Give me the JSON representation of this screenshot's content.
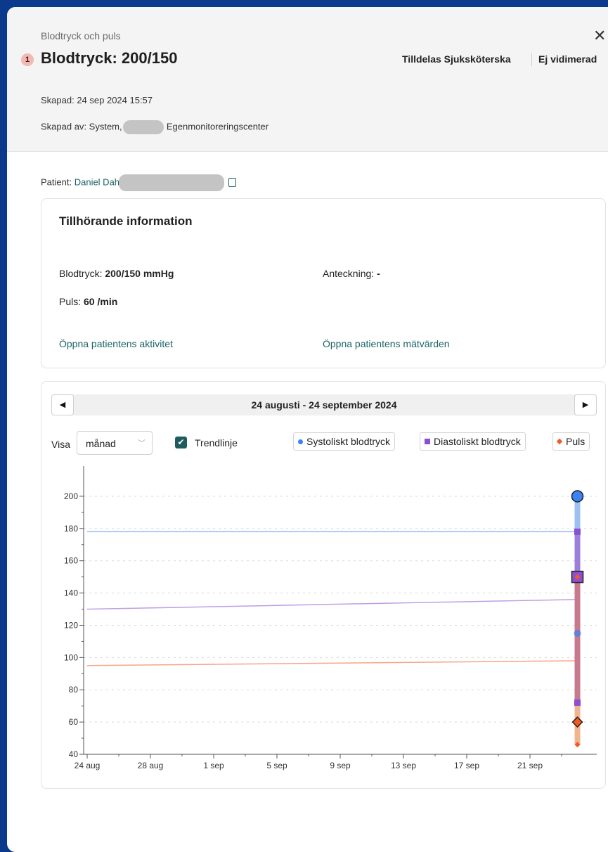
{
  "header": {
    "breadcrumb": "Blodtryck och puls",
    "badge": "1",
    "title": "Blodtryck: 200/150",
    "assign": "Tilldelas Sjuksköterska",
    "verify": "Ej vidimerad",
    "created": "Skapad: 24 sep 2024 15:57",
    "created_by_prefix": "Skapad av: System, I",
    "created_by_suffix": "Egenmonitoreringscenter"
  },
  "patient": {
    "label": "Patient:",
    "name": "Daniel Dah"
  },
  "info": {
    "heading": "Tillhörande information",
    "bp_label": "Blodtryck:",
    "bp_value": "200/150 mmHg",
    "note_label": "Anteckning:",
    "note_value": "-",
    "pulse_label": "Puls:",
    "pulse_value": "60 /min",
    "link_activity": "Öppna patientens aktivitet",
    "link_values": "Öppna patientens mätvärden"
  },
  "chart_controls": {
    "date_range": "24 augusti - 24 september 2024",
    "visa_label": "Visa",
    "period": "månad",
    "trend_label": "Trendlinje",
    "trend_checked": true,
    "legend": [
      {
        "label": "Systoliskt blodtryck",
        "color": "#3b82f6",
        "marker": "circle"
      },
      {
        "label": "Diastoliskt blodtryck",
        "color": "#8b4fd1",
        "marker": "square"
      },
      {
        "label": "Puls",
        "color": "#f05a23",
        "marker": "diamond"
      }
    ]
  },
  "chart_data": {
    "type": "scatter",
    "x_tick_labels": [
      "24 aug",
      "28 aug",
      "1 sep",
      "5 sep",
      "9 sep",
      "13 sep",
      "17 sep",
      "21 sep"
    ],
    "xlim": [
      "2024-08-24",
      "2024-09-25"
    ],
    "ylim": [
      40,
      210
    ],
    "y_ticks": [
      40,
      60,
      80,
      100,
      120,
      140,
      160,
      180,
      200
    ],
    "grid": true,
    "series": [
      {
        "name": "Systoliskt blodtryck",
        "color": "#3b82f6",
        "points": [
          {
            "x": "2024-09-24",
            "y": 200
          },
          {
            "x": "2024-09-24",
            "y": 115
          }
        ],
        "trend": {
          "from": {
            "x": "2024-08-24",
            "y": 178
          },
          "to": {
            "x": "2024-09-24",
            "y": 178
          }
        }
      },
      {
        "name": "Diastoliskt blodtryck",
        "color": "#8b4fd1",
        "points": [
          {
            "x": "2024-09-24",
            "y": 150
          },
          {
            "x": "2024-09-24",
            "y": 178
          },
          {
            "x": "2024-09-24",
            "y": 72
          }
        ],
        "trend": {
          "from": {
            "x": "2024-08-24",
            "y": 130
          },
          "to": {
            "x": "2024-09-24",
            "y": 136
          }
        }
      },
      {
        "name": "Puls",
        "color": "#f05a23",
        "points": [
          {
            "x": "2024-09-24",
            "y": 60
          },
          {
            "x": "2024-09-24",
            "y": 150
          },
          {
            "x": "2024-09-24",
            "y": 46
          }
        ],
        "trend": {
          "from": {
            "x": "2024-08-24",
            "y": 95
          },
          "to": {
            "x": "2024-09-24",
            "y": 98
          }
        }
      }
    ]
  }
}
